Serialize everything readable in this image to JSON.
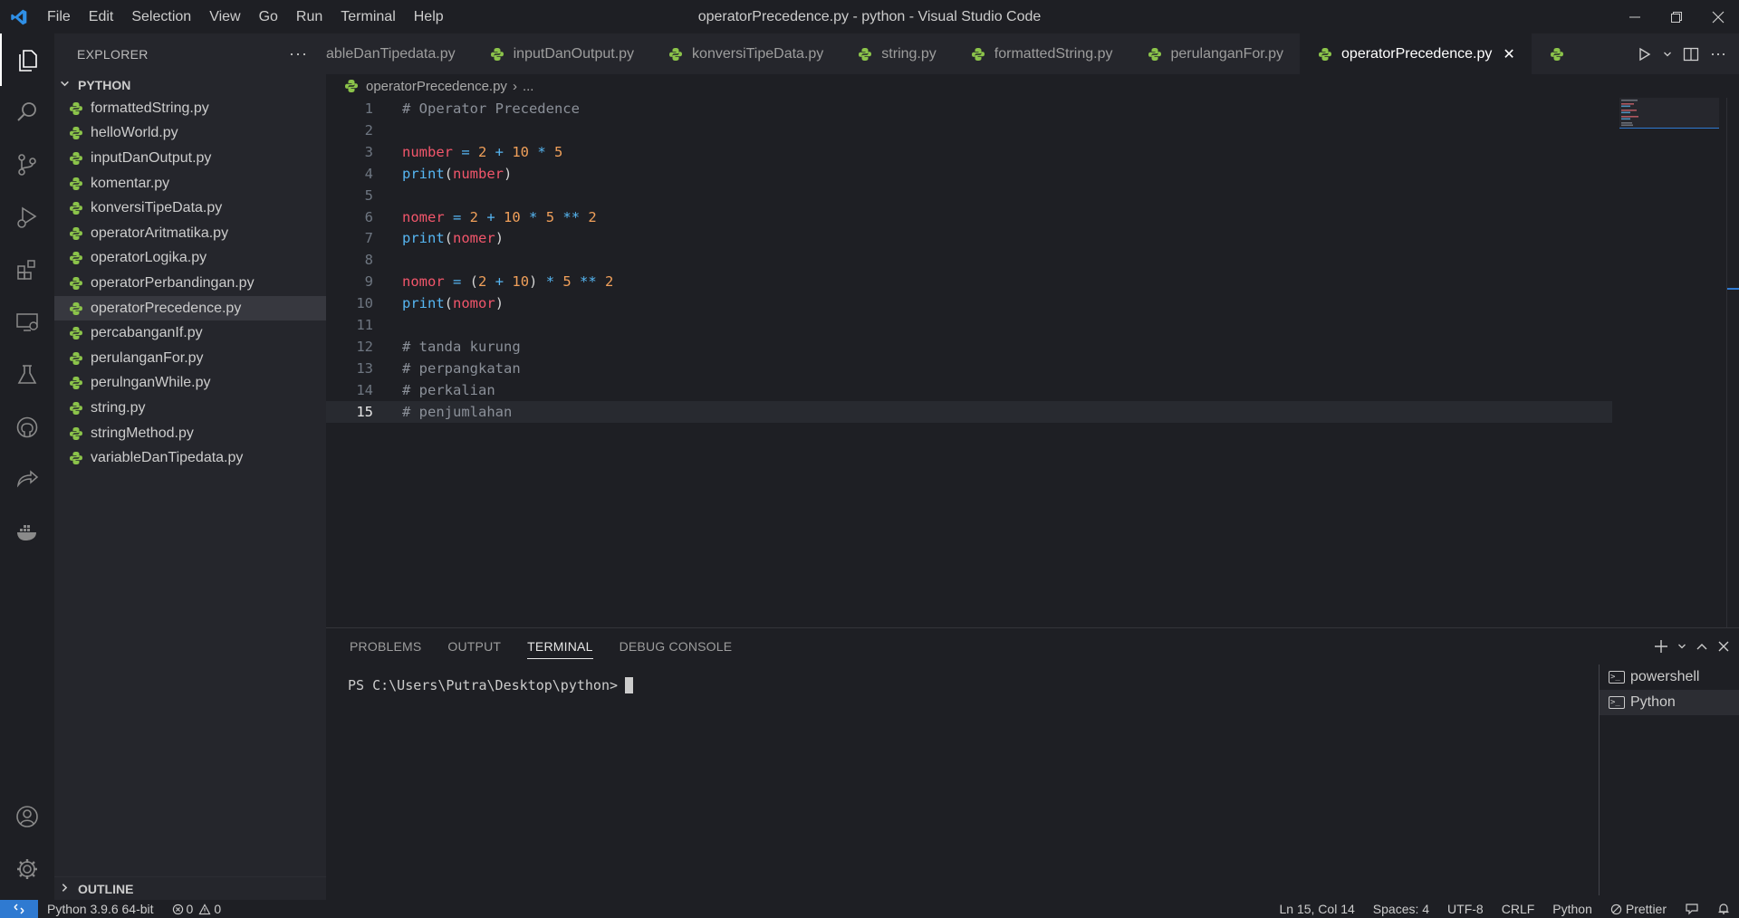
{
  "window": {
    "title": "operatorPrecedence.py - python - Visual Studio Code",
    "menu": [
      "File",
      "Edit",
      "Selection",
      "View",
      "Go",
      "Run",
      "Terminal",
      "Help"
    ]
  },
  "sidebar": {
    "header": "EXPLORER",
    "folder": "PYTHON",
    "files": [
      "formattedString.py",
      "helloWorld.py",
      "inputDanOutput.py",
      "komentar.py",
      "konversiTipeData.py",
      "operatorAritmatika.py",
      "operatorLogika.py",
      "operatorPerbandingan.py",
      "operatorPrecedence.py",
      "percabanganIf.py",
      "perulanganFor.py",
      "perulnganWhile.py",
      "string.py",
      "stringMethod.py",
      "variableDanTipedata.py"
    ],
    "selected_file": "operatorPrecedence.py",
    "outline": "OUTLINE"
  },
  "tabs": [
    "ableDanTipedata.py",
    "inputDanOutput.py",
    "konversiTipeData.py",
    "string.py",
    "formattedString.py",
    "perulanganFor.py",
    "operatorPrecedence.py"
  ],
  "active_tab": "operatorPrecedence.py",
  "breadcrumb": {
    "file": "operatorPrecedence.py",
    "more": "..."
  },
  "editor": {
    "current_line": 15,
    "lines": [
      {
        "n": "1",
        "tokens": [
          [
            "# Operator Precedence",
            "cm"
          ]
        ]
      },
      {
        "n": "2",
        "tokens": []
      },
      {
        "n": "3",
        "tokens": [
          [
            "number",
            "var"
          ],
          [
            " = ",
            "op"
          ],
          [
            "2",
            "num"
          ],
          [
            " + ",
            "op"
          ],
          [
            "10",
            "num"
          ],
          [
            " * ",
            "op"
          ],
          [
            "5",
            "num"
          ]
        ]
      },
      {
        "n": "4",
        "tokens": [
          [
            "print",
            "fn"
          ],
          [
            "(",
            "p"
          ],
          [
            "number",
            "var"
          ],
          [
            ")",
            "p"
          ]
        ]
      },
      {
        "n": "5",
        "tokens": []
      },
      {
        "n": "6",
        "tokens": [
          [
            "nomer",
            "var"
          ],
          [
            " = ",
            "op"
          ],
          [
            "2",
            "num"
          ],
          [
            " + ",
            "op"
          ],
          [
            "10",
            "num"
          ],
          [
            " * ",
            "op"
          ],
          [
            "5",
            "num"
          ],
          [
            " ** ",
            "op"
          ],
          [
            "2",
            "num"
          ]
        ]
      },
      {
        "n": "7",
        "tokens": [
          [
            "print",
            "fn"
          ],
          [
            "(",
            "p"
          ],
          [
            "nomer",
            "var"
          ],
          [
            ")",
            "p"
          ]
        ]
      },
      {
        "n": "8",
        "tokens": []
      },
      {
        "n": "9",
        "tokens": [
          [
            "nomor",
            "var"
          ],
          [
            " = ",
            "op"
          ],
          [
            "(",
            "p"
          ],
          [
            "2",
            "num"
          ],
          [
            " + ",
            "op"
          ],
          [
            "10",
            "num"
          ],
          [
            ")",
            "p"
          ],
          [
            " * ",
            "op"
          ],
          [
            "5",
            "num"
          ],
          [
            " ** ",
            "op"
          ],
          [
            "2",
            "num"
          ]
        ]
      },
      {
        "n": "10",
        "tokens": [
          [
            "print",
            "fn"
          ],
          [
            "(",
            "p"
          ],
          [
            "nomor",
            "var"
          ],
          [
            ")",
            "p"
          ]
        ]
      },
      {
        "n": "11",
        "tokens": []
      },
      {
        "n": "12",
        "tokens": [
          [
            "# tanda kurung",
            "cm"
          ]
        ]
      },
      {
        "n": "13",
        "tokens": [
          [
            "# perpangkatan",
            "cm"
          ]
        ]
      },
      {
        "n": "14",
        "tokens": [
          [
            "# perkalian",
            "cm"
          ]
        ]
      },
      {
        "n": "15",
        "tokens": [
          [
            "# penjumlahan",
            "cm"
          ]
        ]
      }
    ]
  },
  "panel": {
    "tabs": [
      "PROBLEMS",
      "OUTPUT",
      "TERMINAL",
      "DEBUG CONSOLE"
    ],
    "active_tab": "TERMINAL",
    "prompt": "PS C:\\Users\\Putra\\Desktop\\python>",
    "terminals": [
      "powershell",
      "Python"
    ],
    "active_terminal": "Python"
  },
  "statusbar": {
    "interpreter": "Python 3.9.6 64-bit",
    "errors": "0",
    "warnings": "0",
    "position": "Ln 15, Col 14",
    "spaces": "Spaces: 4",
    "encoding": "UTF-8",
    "eol": "CRLF",
    "language": "Python",
    "formatter": "Prettier"
  },
  "colors": {
    "accent": "#2f7ad1",
    "background": "#1e1f24",
    "sidebar": "#25262c",
    "python_icon": "#8bc34a"
  }
}
